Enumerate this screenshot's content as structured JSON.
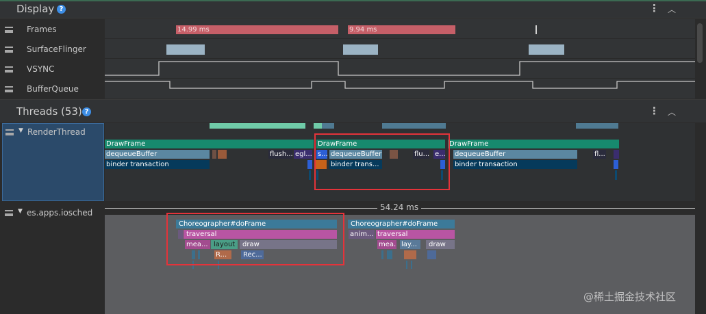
{
  "display_section": {
    "title": "Display",
    "help": "?"
  },
  "tracks": [
    {
      "label": "Frames"
    },
    {
      "label": "SurfaceFlinger"
    },
    {
      "label": "VSYNC"
    },
    {
      "label": "BufferQueue"
    }
  ],
  "frames": {
    "slice1": "14.99 ms",
    "slice2": "9.94 ms"
  },
  "threads_section": {
    "title": "Threads (53)",
    "help": "?"
  },
  "render_thread": {
    "label": "RenderThread",
    "draw_frame": [
      "DrawFrame",
      "DrawFrame",
      "DrawFrame"
    ],
    "dequeue": [
      "dequeueBuffer",
      "dequeueBuffer",
      "dequeueBuffer"
    ],
    "binder": [
      "binder transaction",
      "binder trans...",
      "binder transaction"
    ],
    "misc": [
      "flush...",
      "egl...",
      "s...",
      "flu...",
      "e...",
      "fl..."
    ]
  },
  "app_thread": {
    "label": "es.apps.iosched",
    "duration": "54.24 ms",
    "choreographer": [
      "Choreographer#doFrame",
      "Choreographer#doFrame"
    ],
    "traversal": [
      "traversal",
      "traversal"
    ],
    "anim": "anim...",
    "measure": [
      "mea...",
      "mea..."
    ],
    "layout": [
      "layout",
      "lay..."
    ],
    "draw": [
      "draw",
      "draw"
    ],
    "r": "R...",
    "rec": "Rec..."
  },
  "watermark": "@稀土掘金技术社区",
  "colors": {
    "green": "#178a6e",
    "blue_gray": "#5b87a1",
    "navy": "#063a5b",
    "pink": "#b855a3",
    "red_slice": "#c65f68",
    "highlight": "#e5333a"
  }
}
